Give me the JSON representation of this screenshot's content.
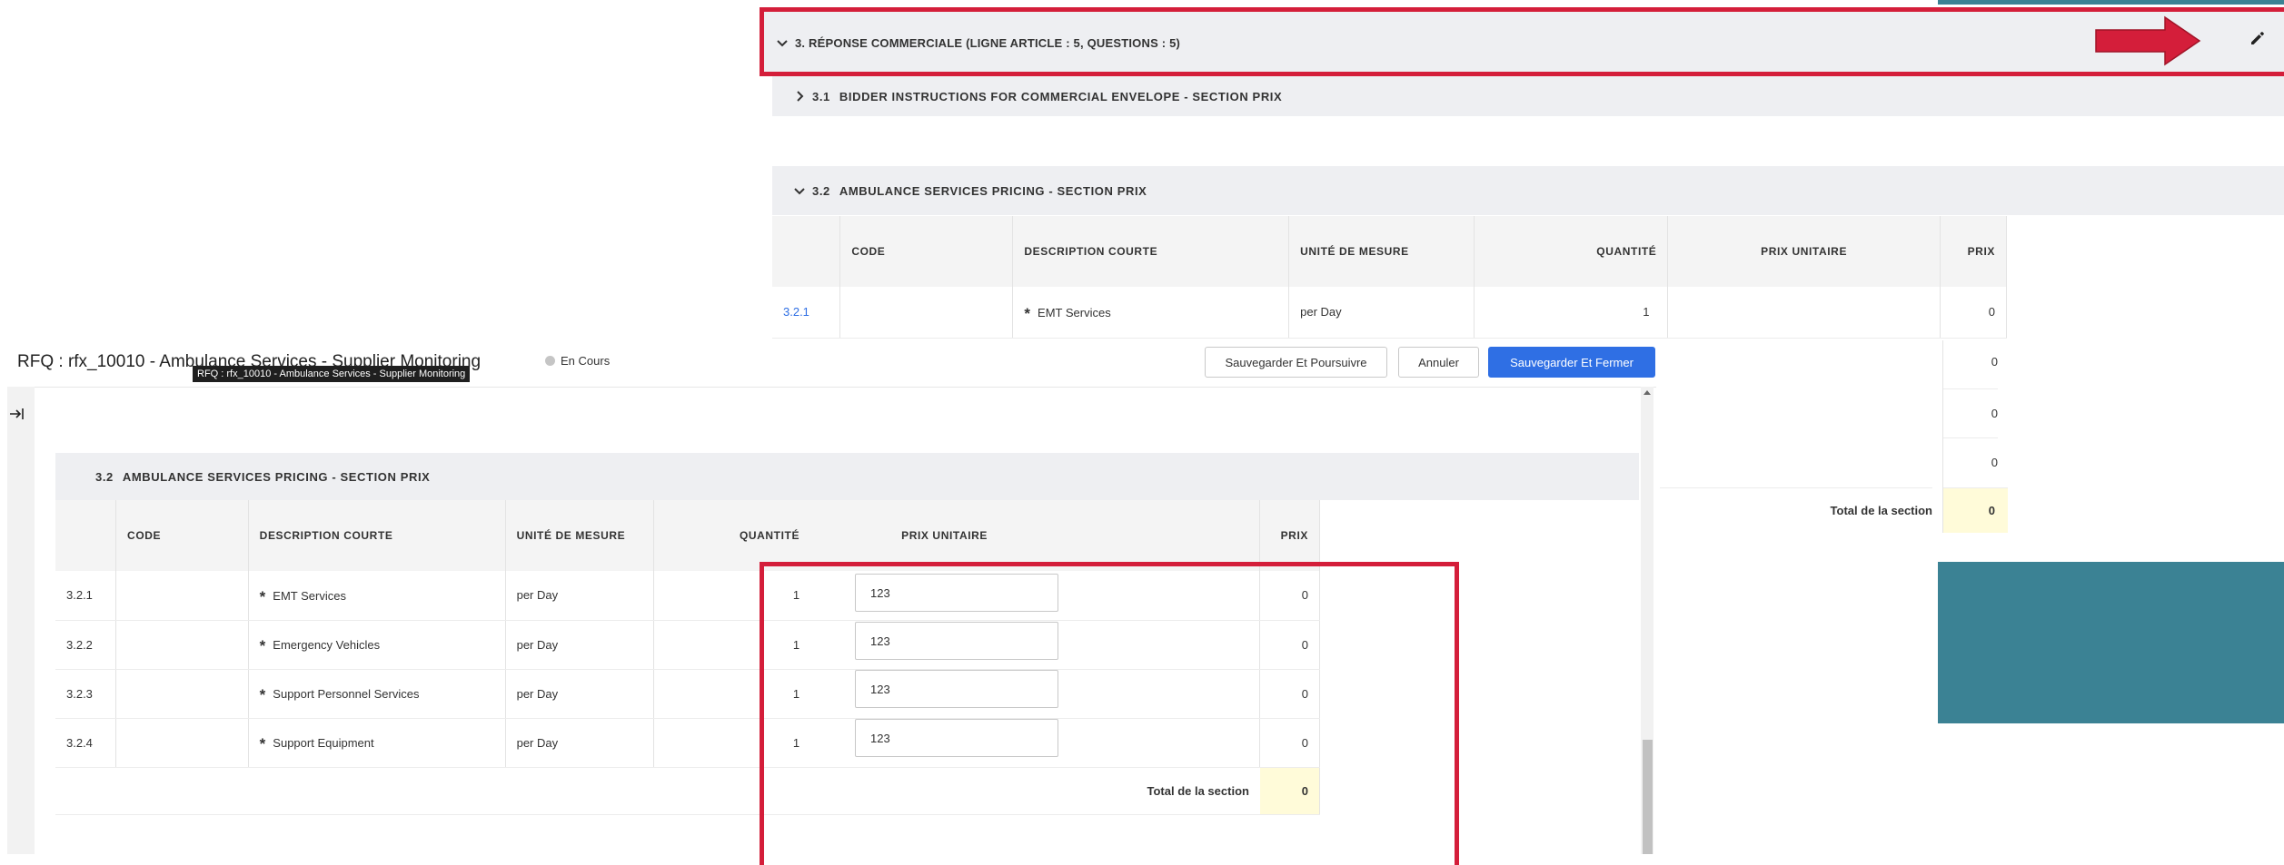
{
  "top": {
    "section3_title": "3. RÉPONSE COMMERCIALE (LIGNE ARTICLE : 5, QUESTIONS : 5)",
    "sub31_num": "3.1",
    "sub31_title": "BIDDER INSTRUCTIONS FOR COMMERCIAL ENVELOPE - SECTION PRIX",
    "sub32_num": "3.2",
    "sub32_title": "AMBULANCE SERVICES PRICING - SECTION PRIX",
    "headers": [
      "CODE",
      "DESCRIPTION COURTE",
      "UNITÉ DE MESURE",
      "QUANTITÉ",
      "PRIX UNITAIRE",
      "PRIX"
    ],
    "row1": {
      "num": "3.2.1",
      "description": "EMT Services",
      "unit": "per Day",
      "qty": "1",
      "price": "0"
    },
    "prices_extra": [
      "0",
      "0",
      "0"
    ],
    "total_label": "Total de la section",
    "total_value": "0"
  },
  "header": {
    "title": "RFQ : rfx_10010 - Ambulance Services - Supplier Monitoring",
    "tooltip": "RFQ : rfx_10010 - Ambulance Services - Supplier Monitoring",
    "status": "En Cours",
    "save_continue": "Sauvegarder Et Poursuivre",
    "cancel": "Annuler",
    "save_close": "Sauvegarder Et Fermer"
  },
  "bottom": {
    "sub32_num": "3.2",
    "sub32_title": "AMBULANCE SERVICES PRICING - SECTION PRIX",
    "headers": [
      "CODE",
      "DESCRIPTION COURTE",
      "UNITÉ DE MESURE",
      "QUANTITÉ",
      "PRIX UNITAIRE",
      "PRIX"
    ],
    "rows": [
      {
        "num": "3.2.1",
        "description": "EMT Services",
        "unit": "per Day",
        "qty": "1",
        "unit_price": "123",
        "price": "0"
      },
      {
        "num": "3.2.2",
        "description": "Emergency Vehicles",
        "unit": "per Day",
        "qty": "1",
        "unit_price": "123",
        "price": "0"
      },
      {
        "num": "3.2.3",
        "description": "Support Personnel Services",
        "unit": "per Day",
        "qty": "1",
        "unit_price": "123",
        "price": "0"
      },
      {
        "num": "3.2.4",
        "description": "Support Equipment",
        "unit": "per Day",
        "qty": "1",
        "unit_price": "123",
        "price": "0"
      }
    ],
    "total_label": "Total de la section",
    "total_value": "0"
  },
  "colors": {
    "highlight_red": "#d41e3a",
    "arrow_red": "#d41e3a",
    "teal_block": "#3b8294",
    "primary_blue": "#2f6fe4",
    "total_bg": "#fffbd9",
    "section_bg": "#eeeff2"
  },
  "icons": {
    "edit": "pencil-icon",
    "expand": "chevron-down-icon",
    "collapse": "chevron-right-icon",
    "sidebar_toggle": "arrow-right-bar-icon"
  }
}
